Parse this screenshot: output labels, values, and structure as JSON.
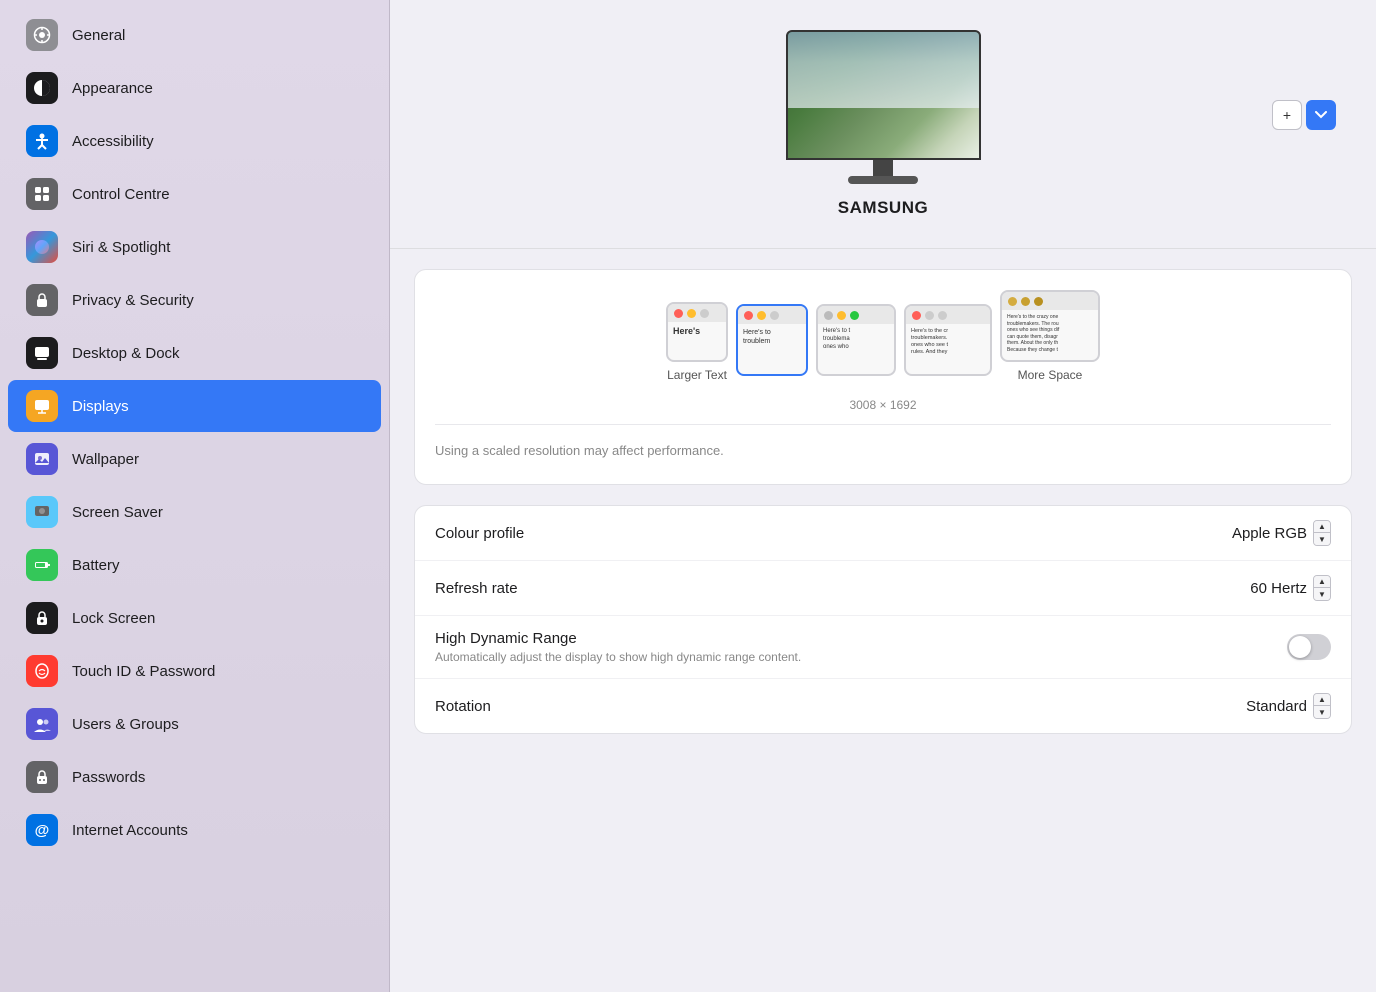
{
  "sidebar": {
    "items": [
      {
        "id": "general",
        "label": "General",
        "icon": "⚙",
        "iconClass": "icon-general",
        "active": false
      },
      {
        "id": "appearance",
        "label": "Appearance",
        "icon": "◑",
        "iconClass": "icon-appearance",
        "active": false
      },
      {
        "id": "accessibility",
        "label": "Accessibility",
        "icon": "♿",
        "iconClass": "icon-accessibility",
        "active": false
      },
      {
        "id": "control-centre",
        "label": "Control Centre",
        "icon": "⊟",
        "iconClass": "icon-control",
        "active": false
      },
      {
        "id": "siri-spotlight",
        "label": "Siri & Spotlight",
        "icon": "◉",
        "iconClass": "icon-siri",
        "active": false
      },
      {
        "id": "privacy-security",
        "label": "Privacy & Security",
        "icon": "🔒",
        "iconClass": "icon-privacy",
        "active": false
      },
      {
        "id": "desktop-dock",
        "label": "Desktop & Dock",
        "icon": "▬",
        "iconClass": "icon-desktop",
        "active": false
      },
      {
        "id": "displays",
        "label": "Displays",
        "icon": "☀",
        "iconClass": "icon-displays",
        "active": true
      },
      {
        "id": "wallpaper",
        "label": "Wallpaper",
        "icon": "✿",
        "iconClass": "icon-wallpaper",
        "active": false
      },
      {
        "id": "screen-saver",
        "label": "Screen Saver",
        "icon": "⬛",
        "iconClass": "icon-screensaver",
        "active": false
      },
      {
        "id": "battery",
        "label": "Battery",
        "icon": "🔋",
        "iconClass": "icon-battery",
        "active": false
      },
      {
        "id": "lock-screen",
        "label": "Lock Screen",
        "icon": "🔒",
        "iconClass": "icon-lockscreen",
        "active": false
      },
      {
        "id": "touch-id",
        "label": "Touch ID & Password",
        "icon": "✋",
        "iconClass": "icon-touchid",
        "active": false
      },
      {
        "id": "users-groups",
        "label": "Users & Groups",
        "icon": "👥",
        "iconClass": "icon-users",
        "active": false
      },
      {
        "id": "passwords",
        "label": "Passwords",
        "icon": "🔑",
        "iconClass": "icon-passwords",
        "active": false
      },
      {
        "id": "internet-accounts",
        "label": "Internet Accounts",
        "icon": "@",
        "iconClass": "icon-internet",
        "active": false
      }
    ]
  },
  "display": {
    "monitor_name": "SAMSUNG",
    "add_label": "+",
    "resolution_label": "3008 × 1692",
    "performance_note": "Using a scaled resolution may affect performance.",
    "thumbnails": [
      {
        "id": "larger-text",
        "label": "Larger Text",
        "selected": false,
        "traffic": [
          "red",
          "yellow",
          "gray"
        ],
        "size": "small"
      },
      {
        "id": "selected-res",
        "label": "",
        "selected": true,
        "traffic": [
          "red",
          "yellow",
          "gray"
        ],
        "size": "medium"
      },
      {
        "id": "default",
        "label": "",
        "selected": false,
        "traffic": [
          "gray",
          "yellow",
          "green"
        ],
        "size": "medium"
      },
      {
        "id": "smaller1",
        "label": "",
        "selected": false,
        "traffic": [
          "red",
          "gray",
          "gray"
        ],
        "size": "large"
      },
      {
        "id": "more-space",
        "label": "More Space",
        "selected": false,
        "traffic": [
          "orange",
          "yellow",
          "gray"
        ],
        "size": "large"
      }
    ],
    "settings": [
      {
        "id": "colour-profile",
        "title": "Colour profile",
        "subtitle": "",
        "value": "Apple RGB",
        "type": "stepper"
      },
      {
        "id": "refresh-rate",
        "title": "Refresh rate",
        "subtitle": "",
        "value": "60 Hertz",
        "type": "stepper"
      },
      {
        "id": "hdr",
        "title": "High Dynamic Range",
        "subtitle": "Automatically adjust the display to show high dynamic range content.",
        "value": "",
        "type": "toggle",
        "toggled": false
      },
      {
        "id": "rotation",
        "title": "Rotation",
        "subtitle": "",
        "value": "Standard",
        "type": "stepper"
      }
    ]
  }
}
